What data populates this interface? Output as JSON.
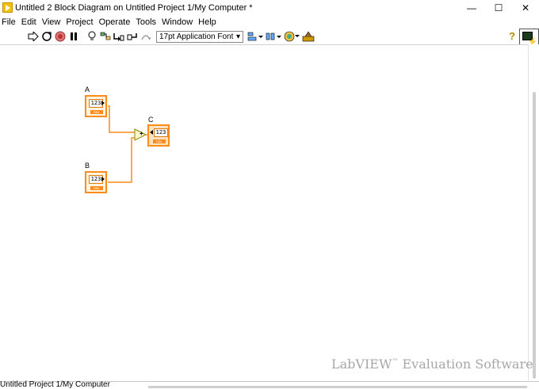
{
  "window": {
    "title": "Untitled 2 Block Diagram on Untitled Project 1/My Computer *",
    "minimize": "—",
    "maximize": "☐",
    "close": "✕"
  },
  "menu": [
    "File",
    "Edit",
    "View",
    "Project",
    "Operate",
    "Tools",
    "Window",
    "Help"
  ],
  "toolbar": {
    "run_icon": "run-arrow-icon",
    "run_continuous_icon": "run-continuously-icon",
    "abort_icon": "abort-icon",
    "pause_icon": "pause-icon",
    "highlight_icon": "highlight-execution-icon",
    "retain_wire_icon": "retain-wire-values-icon",
    "step_into_icon": "step-into-icon",
    "step_out_icon": "step-out-icon",
    "font_select": "17pt Application Font",
    "align_icon": "align-objects-icon",
    "distribute_icon": "distribute-objects-icon",
    "reorder_icon": "reorder-icon",
    "cleanup_icon": "clean-up-diagram-icon",
    "help_icon": "?"
  },
  "diagram": {
    "nodes": [
      {
        "label": "A",
        "type": "numeric-control",
        "value": "123",
        "tag": "DBL"
      },
      {
        "label": "B",
        "type": "numeric-control",
        "value": "123",
        "tag": "DBL"
      },
      {
        "label": "C",
        "type": "numeric-indicator",
        "value": "123",
        "tag": "DBL"
      }
    ],
    "add_symbol": "+"
  },
  "watermark": {
    "text1": "LabVIEW",
    "tm": "™",
    "text2": "Evaluation Software"
  },
  "status": {
    "text": "Untitled Project 1/My Computer"
  },
  "colors": {
    "wire": "#ff8c1a",
    "terminal_border": "#ff8c1a",
    "add_fill": "#fff7cc",
    "add_border": "#8a8a00"
  }
}
